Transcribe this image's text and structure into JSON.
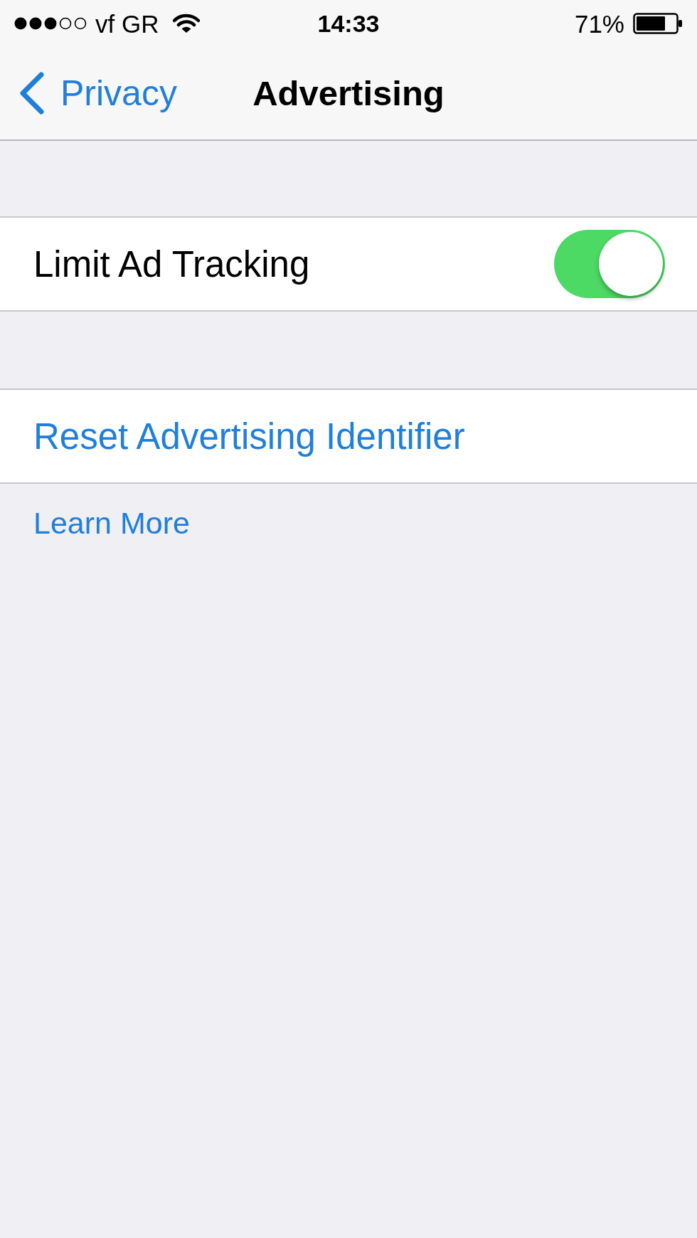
{
  "status_bar": {
    "carrier": "vf GR",
    "time": "14:33",
    "battery": "71%"
  },
  "nav_bar": {
    "back": "Privacy",
    "title": "Advertising"
  },
  "sections": [
    {
      "kind": "toggle",
      "label": "Limit Ad Tracking",
      "on": true
    },
    {
      "kind": "action",
      "label": "Reset Advertising Identifier"
    }
  ],
  "footer_link": "Learn More"
}
